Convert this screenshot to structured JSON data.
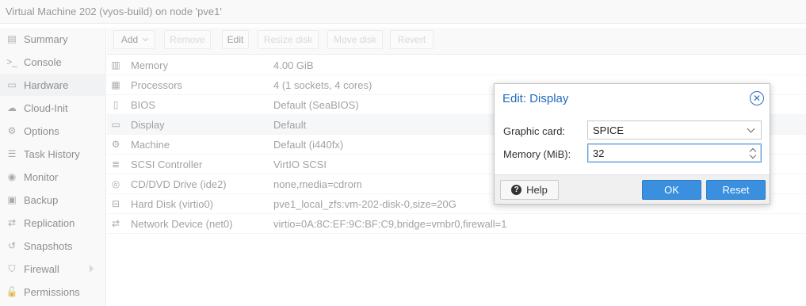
{
  "window": {
    "title": "Virtual Machine 202 (vyos-build) on node 'pve1'"
  },
  "sidebar": {
    "items": [
      {
        "label": "Summary",
        "icon": "summary-icon",
        "glyph": "▤"
      },
      {
        "label": "Console",
        "icon": "terminal-icon",
        "glyph": ">_"
      },
      {
        "label": "Hardware",
        "icon": "monitor-icon",
        "glyph": "▭",
        "selected": true
      },
      {
        "label": "Cloud-Init",
        "icon": "cloud-icon",
        "glyph": "☁"
      },
      {
        "label": "Options",
        "icon": "gear-icon",
        "glyph": "⚙"
      },
      {
        "label": "Task History",
        "icon": "list-icon",
        "glyph": "☰"
      },
      {
        "label": "Monitor",
        "icon": "eye-icon",
        "glyph": "◉"
      },
      {
        "label": "Backup",
        "icon": "floppy-icon",
        "glyph": "▣"
      },
      {
        "label": "Replication",
        "icon": "retweet-icon",
        "glyph": "⇄"
      },
      {
        "label": "Snapshots",
        "icon": "history-icon",
        "glyph": "↺"
      },
      {
        "label": "Firewall",
        "icon": "shield-icon",
        "glyph": "⛉"
      },
      {
        "label": "Permissions",
        "icon": "unlock-icon",
        "glyph": "🔓"
      }
    ]
  },
  "toolbar": {
    "add_label": "Add",
    "remove_label": "Remove",
    "edit_label": "Edit",
    "resize_label": "Resize disk",
    "move_label": "Move disk",
    "revert_label": "Revert"
  },
  "hardware": {
    "rows": [
      {
        "name": "Memory",
        "value": "4.00 GiB",
        "icon": "memory-icon",
        "glyph": "▥"
      },
      {
        "name": "Processors",
        "value": "4 (1 sockets, 4 cores)",
        "icon": "cpu-icon",
        "glyph": "▦"
      },
      {
        "name": "BIOS",
        "value": "Default (SeaBIOS)",
        "icon": "microchip-icon",
        "glyph": "▯"
      },
      {
        "name": "Display",
        "value": "Default",
        "icon": "desktop-icon",
        "glyph": "▭",
        "selected": true
      },
      {
        "name": "Machine",
        "value": "Default (i440fx)",
        "icon": "cogs-icon",
        "glyph": "⚙"
      },
      {
        "name": "SCSI Controller",
        "value": "VirtIO SCSI",
        "icon": "database-icon",
        "glyph": "≣"
      },
      {
        "name": "CD/DVD Drive (ide2)",
        "value": "none,media=cdrom",
        "icon": "cdrom-icon",
        "glyph": "◎"
      },
      {
        "name": "Hard Disk (virtio0)",
        "value": "pve1_local_zfs:vm-202-disk-0,size=20G",
        "icon": "hdd-icon",
        "glyph": "⊟"
      },
      {
        "name": "Network Device (net0)",
        "value": "virtio=0A:8C:EF:9C:BF:C9,bridge=vmbr0,firewall=1",
        "icon": "exchange-icon",
        "glyph": "⇄"
      }
    ]
  },
  "dialog": {
    "title": "Edit: Display",
    "graphic_card_label": "Graphic card:",
    "graphic_card_value": "SPICE",
    "memory_label": "Memory (MiB):",
    "memory_value": "32",
    "help_label": "Help",
    "ok_label": "OK",
    "reset_label": "Reset"
  },
  "colors": {
    "accent": "#3a8fde",
    "title_blue": "#1f6bbf",
    "selected_row": "#eef1f5"
  }
}
